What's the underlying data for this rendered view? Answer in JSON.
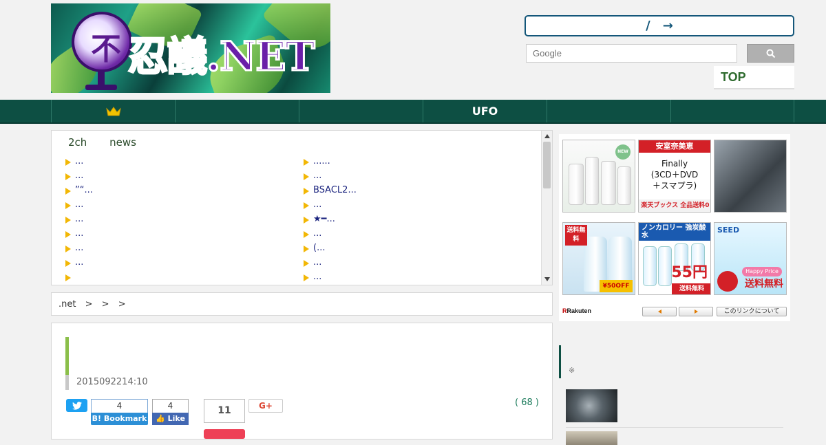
{
  "header": {
    "logo_text": "忍議.NET",
    "logo_orb_char": "不",
    "nav_box_slash": "/",
    "nav_box_arrow": "→",
    "search_placeholder": "Google",
    "top_link": "TOP"
  },
  "nav": {
    "items": [
      {
        "label": "",
        "icon": "crown-icon"
      },
      {
        "label": ""
      },
      {
        "label": ""
      },
      {
        "label": "UFO"
      },
      {
        "label": ""
      },
      {
        "label": ""
      }
    ]
  },
  "feed": {
    "tabs": [
      "2ch",
      "news"
    ],
    "left": [
      "...",
      "...",
      "”“...",
      "...",
      "...",
      "...",
      "...",
      "...",
      ""
    ],
    "right": [
      "......",
      "...",
      "BSACL2...",
      "...",
      "★━...",
      "...",
      "(...",
      "...",
      "..."
    ]
  },
  "breadcrumb": {
    "items": [
      ".net",
      ">",
      ">",
      ">"
    ]
  },
  "article": {
    "date": "2015092214:10",
    "hatena_count": "4",
    "hatena_label": "B! Bookmark",
    "fb_count": "4",
    "fb_label": "Like",
    "pocket_count": "11",
    "gplus_label": "G+",
    "comments": "( 68 )"
  },
  "ads": {
    "ad2_header": "安室奈美恵",
    "ad2_line1": "Finally",
    "ad2_line2": "(3CD＋DVD",
    "ad2_line3": "＋スマプラ)",
    "ad2_footer": "楽天ブックス 全品送料0円",
    "ad4_tag": "送料無料",
    "ad4_sale": "¥50OFF",
    "ad5_header": "ノンカロリー 強炭酸水",
    "ad5_price": "55円",
    "ad5_footer": "送料無料",
    "ad6_brand": "SEED",
    "ad6_pill": "Happy Price",
    "ad6_free": "送料無料",
    "ad1_new": "NEW",
    "rakuten": "Rakuten",
    "link_about": "このリンクについて"
  },
  "sidebar": {
    "note": "※"
  },
  "colors": {
    "nav_bg": "#0d4f43",
    "accent_green": "#8bbf4a",
    "link_blue": "#1a237e",
    "bullet_yellow": "#f2b705"
  }
}
